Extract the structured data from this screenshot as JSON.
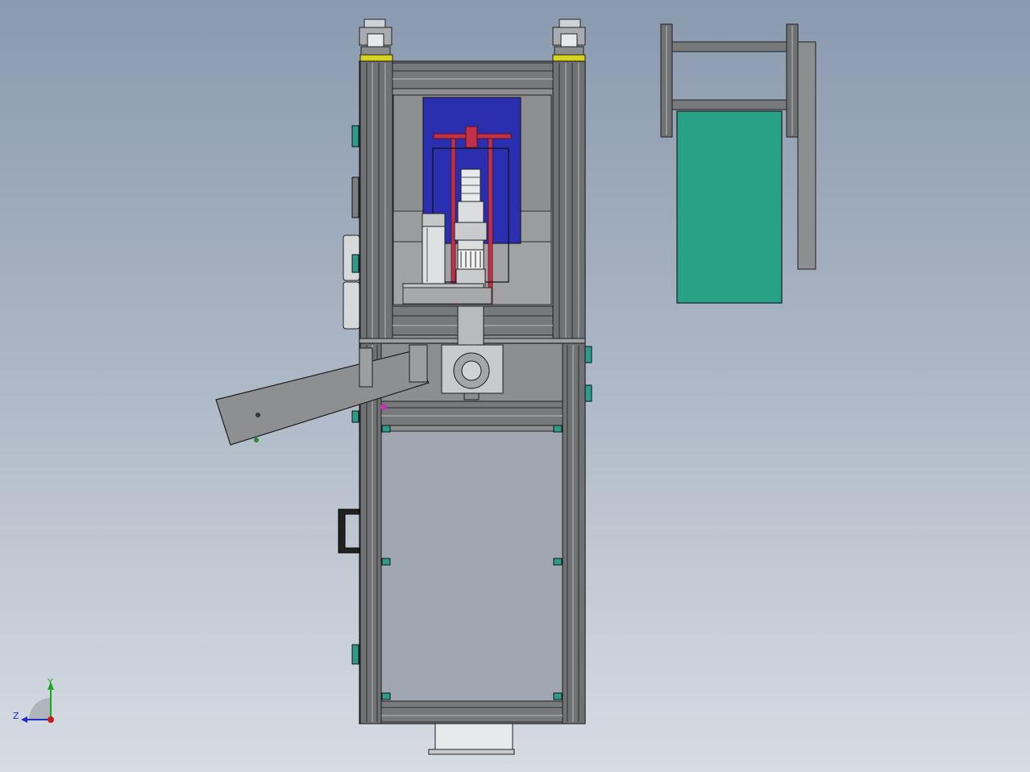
{
  "view": {
    "colors": {
      "frame": "#6f7173",
      "frame_dark": "#2e3032",
      "panel_gray": "#8c8e8f",
      "panel_blue": "#2a2fb0",
      "accent_red": "#c0324a",
      "teal_panel": "#27a287",
      "yellow_band": "#d9d21a",
      "bracket_teal": "#2d9c8a"
    }
  },
  "triad": {
    "x_label": "",
    "y_label": "Y",
    "z_label": "Z",
    "x_color": "#d01818",
    "y_color": "#1ea51e",
    "z_color": "#1a2fd0"
  }
}
